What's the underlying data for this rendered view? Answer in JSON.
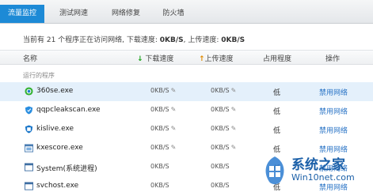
{
  "tabs": [
    {
      "label": "流量监控",
      "active": true
    },
    {
      "label": "测试网速",
      "active": false
    },
    {
      "label": "网络修复",
      "active": false
    },
    {
      "label": "防火墙",
      "active": false
    }
  ],
  "summary": {
    "prefix": "当前有 21 个程序正在访问网络, 下载速度: ",
    "download": "0KB/S",
    "middle": ", 上传速度: ",
    "upload": "0KB/S"
  },
  "columns": {
    "name": "名称",
    "down": "下载速度",
    "up": "上传速度",
    "level": "占用程度",
    "action": "操作"
  },
  "group_label": "运行的程序",
  "rows": [
    {
      "name": "360se.exe",
      "down": "0KB/S",
      "up": "0KB/S",
      "level": "低",
      "action": "禁用网络",
      "icon": "360se-icon",
      "selected": true
    },
    {
      "name": "qqpcleakscan.exe",
      "down": "0KB/S",
      "up": "0KB/S",
      "level": "低",
      "action": "禁用网络",
      "icon": "shield-icon"
    },
    {
      "name": "kislive.exe",
      "down": "0KB/S",
      "up": "0KB/S",
      "level": "低",
      "action": "禁用网络",
      "icon": "kingsoft-icon"
    },
    {
      "name": "kxescore.exe",
      "down": "0KB/S",
      "up": "0KB/S",
      "level": "低",
      "action": "禁用网络",
      "icon": "application-icon"
    },
    {
      "name": "System(系统进程)",
      "down": "0KB/S",
      "up": "0KB/S",
      "level": "低",
      "action": "禁用网络",
      "icon": "window-icon"
    },
    {
      "name": "svchost.exe",
      "down": "0KB/S",
      "up": "0KB/S",
      "level": "低",
      "action": "禁用网络",
      "icon": "window-icon"
    }
  ],
  "watermark": {
    "title": "系统之家",
    "subtitle": "Win10net.com"
  },
  "colors": {
    "accent": "#1d8ad6",
    "link": "#2a74c6",
    "selected_row": "#e4f0fb"
  }
}
